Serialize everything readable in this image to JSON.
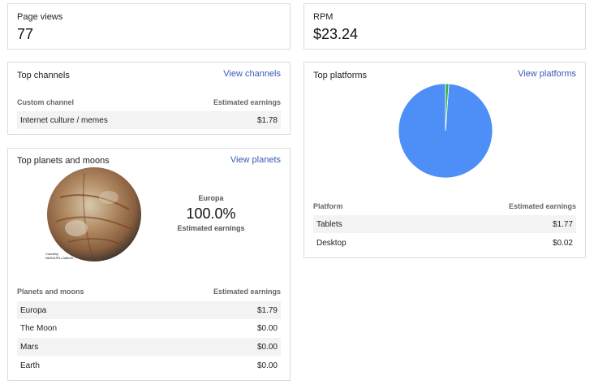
{
  "page_views": {
    "label": "Page views",
    "value": "77"
  },
  "rpm": {
    "label": "RPM",
    "value": "$23.24"
  },
  "top_channels": {
    "title": "Top channels",
    "link": "View channels",
    "columns": [
      "Custom channel",
      "Estimated earnings"
    ],
    "rows": [
      {
        "name": "Internet culture / memes",
        "earnings": "$1.78"
      }
    ]
  },
  "top_planets": {
    "title": "Top planets and moons",
    "link": "View planets",
    "featured": {
      "name": "Europa",
      "percent": "100.0%",
      "metric": "Estimated earnings"
    },
    "image_credit": [
      "Courtesy",
      "NASA/JPL-Caltech"
    ],
    "columns": [
      "Planets and moons",
      "Estimated earnings"
    ],
    "rows": [
      {
        "name": "Europa",
        "earnings": "$1.79"
      },
      {
        "name": "The Moon",
        "earnings": "$0.00"
      },
      {
        "name": "Mars",
        "earnings": "$0.00"
      },
      {
        "name": "Earth",
        "earnings": "$0.00"
      }
    ]
  },
  "top_platforms": {
    "title": "Top platforms",
    "link": "View platforms",
    "columns": [
      "Platform",
      "Estimated earnings"
    ],
    "rows": [
      {
        "name": "Tablets",
        "earnings": "$1.77"
      },
      {
        "name": "Desktop",
        "earnings": "$0.02"
      }
    ]
  },
  "chart_data": {
    "type": "pie",
    "categories": [
      "Tablets",
      "Desktop"
    ],
    "values": [
      1.77,
      0.02
    ],
    "colors": [
      "#4d8ff7",
      "#33b24b"
    ]
  },
  "colors": {
    "link": "#3b5bb6",
    "row_shade": "#f3f3f3",
    "border": "#dcdcdc"
  }
}
